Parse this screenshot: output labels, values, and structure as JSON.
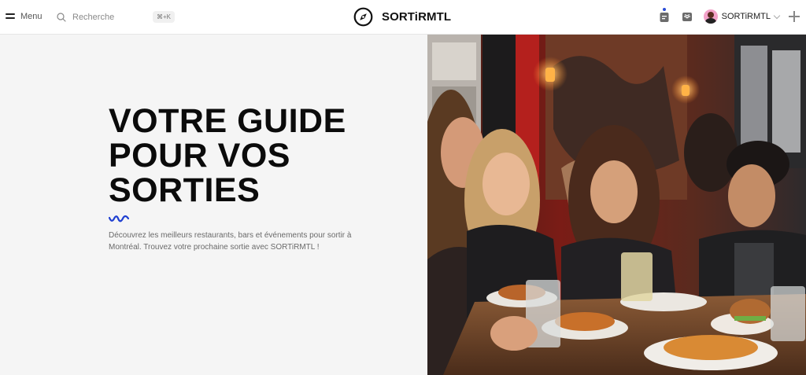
{
  "header": {
    "menu_label": "Menu",
    "search_placeholder": "Recherche",
    "search_shortcut": "⌘+K",
    "brand_name": "SORTiRMTL",
    "account_name": "SORTiRMTL"
  },
  "hero": {
    "title_lines": [
      "VOTRE GUIDE",
      "POUR VOS",
      "SORTIES"
    ],
    "description_line1": "Découvrez les meilleurs restaurants, bars et événements pour sortir à",
    "description_line2": "Montréal. Trouvez votre prochaine sortie avec SORTiRMTL !"
  },
  "colors": {
    "accent": "#1f3fd1",
    "hero_bg": "#f5f5f5",
    "header_bg": "#ffffff"
  },
  "icons": {
    "menu": "menu-icon",
    "search": "search-icon",
    "brand": "compass-icon",
    "events": "calendar-icon",
    "inbox": "inbox-icon",
    "add": "plus-icon"
  }
}
